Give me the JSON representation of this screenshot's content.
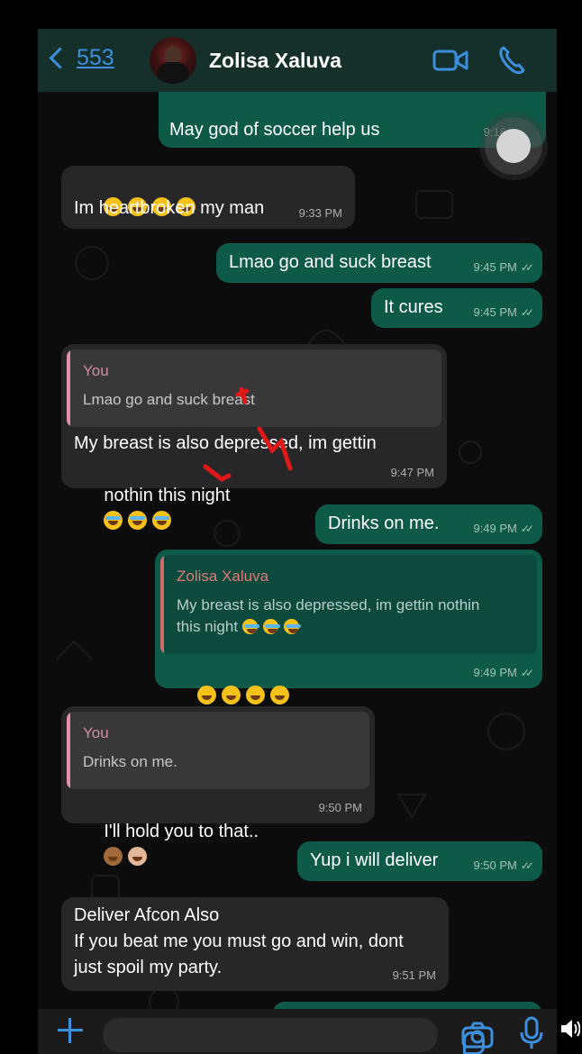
{
  "header": {
    "back_count": "553",
    "contact_name": "Zolisa Xaluva"
  },
  "messages": [
    {
      "dir": "out",
      "text": "May god of soccer help us",
      "time": "9:16"
    },
    {
      "dir": "in",
      "text": "Im heartbroken my man",
      "emoji": "🤣🤣🤣🤣",
      "time": "9:33 PM"
    },
    {
      "dir": "out",
      "text": "Lmao go and suck breast",
      "time": "9:45 PM"
    },
    {
      "dir": "out",
      "text": "It cures",
      "time": "9:45 PM"
    },
    {
      "dir": "in",
      "quote_name": "You",
      "quote_text": "Lmao go and suck breast",
      "text1": "My breast is also depressed, im gettin",
      "text2": "nothin this night",
      "time": "9:47 PM"
    },
    {
      "dir": "out",
      "text": "Drinks on me.",
      "time": "9:49 PM"
    },
    {
      "dir": "out",
      "quote_name": "Zolisa Xaluva",
      "quote_text1": "My breast is also depressed, im gettin nothin",
      "quote_text2": "this night",
      "time": "9:49 PM"
    },
    {
      "dir": "in",
      "quote_name": "You",
      "quote_text": "Drinks on me.",
      "text": "I'll hold you to that..",
      "time": "9:50 PM"
    },
    {
      "dir": "out",
      "text": "Yup i will deliver",
      "time": "9:50 PM"
    },
    {
      "dir": "in",
      "text1": "Deliver Afcon Also",
      "text2": "If you beat me you must go and win, dont",
      "text3": "just spoil my party.",
      "time": "9:51 PM"
    }
  ],
  "colors": {
    "incoming": "#272729",
    "outgoing": "#0e5a49",
    "accent": "#3c8fdc",
    "header": "#15302b"
  },
  "icons": [
    "chevron-left-icon",
    "video-call-icon",
    "phone-icon",
    "plus-icon",
    "sticker-icon",
    "camera-icon",
    "mic-icon",
    "speaker-icon"
  ]
}
